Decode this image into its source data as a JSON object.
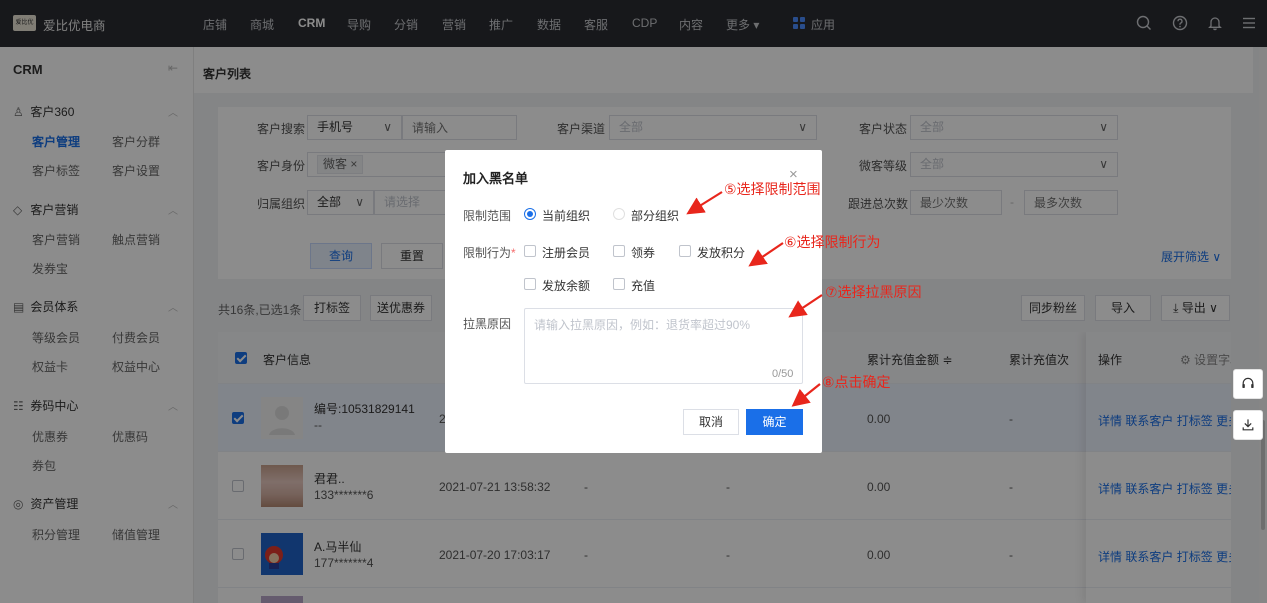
{
  "topbar": {
    "brand": "爱比优电商",
    "logo_text": "爱比优",
    "nav": [
      "店铺",
      "商城",
      "CRM",
      "导购",
      "分销",
      "营销",
      "推广",
      "数据",
      "客服",
      "CDP",
      "内容",
      "更多 ▾",
      "应用"
    ],
    "active_nav": "CRM",
    "icons": [
      "search-icon",
      "help-icon",
      "bell-icon",
      "menu-icon"
    ]
  },
  "sidebar": {
    "title": "CRM",
    "collapse_icon": "⇤",
    "sections": [
      {
        "label": "客户360",
        "icon": "users-icon",
        "items": [
          "客户管理",
          "客户分群",
          "客户标签",
          "客户设置"
        ]
      },
      {
        "label": "客户营销",
        "icon": "diamond-icon",
        "items": [
          "客户营销",
          "触点营销",
          "发券宝"
        ]
      },
      {
        "label": "会员体系",
        "icon": "member-card-icon",
        "items": [
          "等级会员",
          "付费会员",
          "权益卡",
          "权益中心"
        ]
      },
      {
        "label": "券码中心",
        "icon": "ticket-icon",
        "items": [
          "优惠券",
          "优惠码",
          "券包"
        ]
      },
      {
        "label": "资产管理",
        "icon": "coins-icon",
        "items": [
          "积分管理",
          "储值管理"
        ]
      }
    ],
    "active_item": "客户管理"
  },
  "page": {
    "title": "客户列表"
  },
  "filters": {
    "search_label": "客户搜索",
    "search_type": "手机号",
    "search_placeholder": "请输入",
    "channel_label": "客户渠道",
    "channel_value": "全部",
    "status_label": "客户状态",
    "status_value": "全部",
    "identity_label": "客户身份",
    "identity_tag": "微客",
    "wechat_level_label": "微客等级",
    "wechat_level_value": "全部",
    "org_label": "归属组织",
    "org_value": "全部",
    "org_placeholder": "请选择",
    "follow_label": "跟进总次数",
    "follow_min_placeholder": "最少次数",
    "follow_sep": "-",
    "follow_max_placeholder": "最多次数",
    "query_button": "查询",
    "reset_button": "重置",
    "expand_label": "展开筛选 ∨"
  },
  "toolbar": {
    "summary": "共16条,已选1条",
    "tag_button": "打标签",
    "coupon_button": "送优惠券",
    "sync_button": "同步粉丝",
    "import_button": "导入",
    "export_button": "导出 ∨"
  },
  "table": {
    "headers": {
      "customer": "客户信息",
      "recharge_amount": "累计充值金额 ≑",
      "recharge_times": "累计充值次",
      "ops": "操作",
      "settings": "设置字段"
    },
    "rows": [
      {
        "name": "编号:10531829141",
        "phone": "--",
        "time": "2",
        "col3": "",
        "col4": "",
        "amount": "0.00",
        "times": "-",
        "selected": true
      },
      {
        "name": "君君..",
        "phone": "133*******6",
        "time": "2021-07-21 13:58:32",
        "col3": "-",
        "col4": "-",
        "amount": "0.00",
        "times": "-",
        "selected": false
      },
      {
        "name": "A.马半仙",
        "phone": "177*******4",
        "time": "2021-07-20 17:03:17",
        "col3": "-",
        "col4": "-",
        "amount": "0.00",
        "times": "-",
        "selected": false
      }
    ],
    "row_actions": [
      "详情",
      "联系客户",
      "打标签",
      "更多"
    ]
  },
  "dialog": {
    "title": "加入黑名单",
    "close": "×",
    "scope_label": "限制范围",
    "scope_options": [
      "当前组织",
      "部分组织"
    ],
    "scope_selected": "当前组织",
    "behavior_label": "限制行为",
    "required_mark": "*",
    "behavior_options": [
      "注册会员",
      "领券",
      "发放积分",
      "发放余额",
      "充值"
    ],
    "reason_label": "拉黑原因",
    "reason_placeholder": "请输入拉黑原因，例如：退货率超过90%",
    "reason_value": "",
    "counter": "0/50",
    "cancel": "取消",
    "confirm": "确定"
  },
  "annotations": {
    "step5": "⑤选择限制范围",
    "step6": "⑥选择限制行为",
    "step7": "⑦选择拉黑原因",
    "step8": "⑧点击确定",
    "color": "#e8261c"
  },
  "colors": {
    "topbar": "#2b2d32",
    "primary": "#1a6fe8",
    "overlay": "rgba(0,0,0,0.45)"
  }
}
